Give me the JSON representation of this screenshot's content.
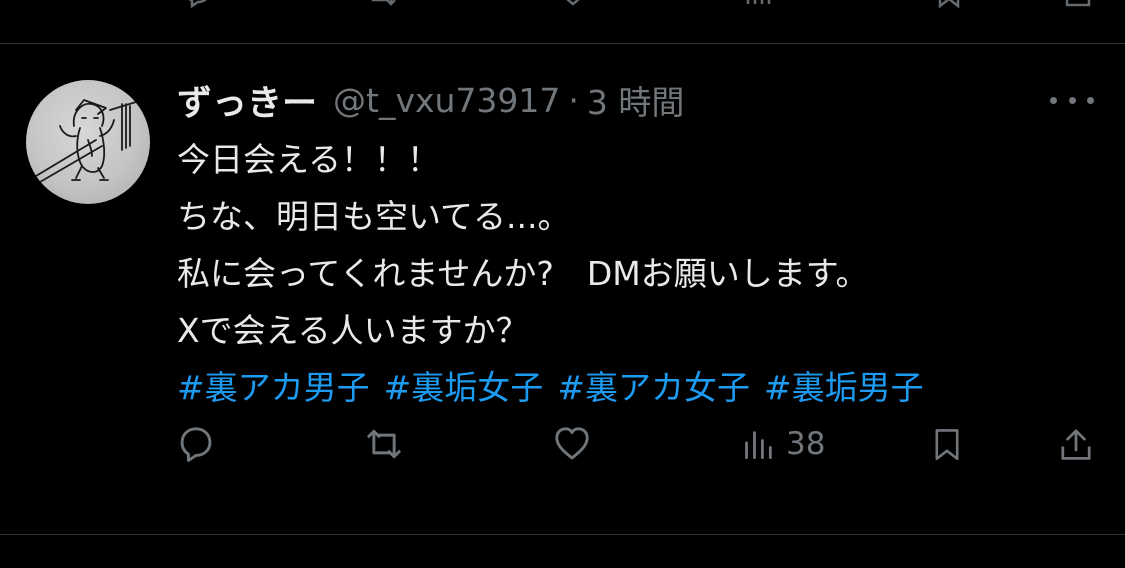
{
  "tweet": {
    "display_name": "ずっきー",
    "handle": "@t_vxu73917",
    "separator": "·",
    "time": "3 時間",
    "lines": [
      "今日会える！！！",
      "ちな、明日も空いてる...。",
      "私に会ってくれませんか?　DMお願いします。",
      "Xで会える人いますか？"
    ],
    "hashtags": [
      "#裏アカ男子",
      "#裏垢女子",
      "#裏アカ女子",
      "#裏垢男子"
    ],
    "views": "38"
  },
  "icons": {
    "more": "more-icon",
    "reply": "reply-icon",
    "retweet": "retweet-icon",
    "like": "heart-icon",
    "views": "bar-chart-icon",
    "bookmark": "bookmark-icon",
    "share": "share-icon"
  },
  "colors": {
    "background": "#000000",
    "text": "#e7e9ea",
    "muted": "#71767b",
    "hashtag": "#1d9bf0",
    "divider": "#2f3336"
  }
}
